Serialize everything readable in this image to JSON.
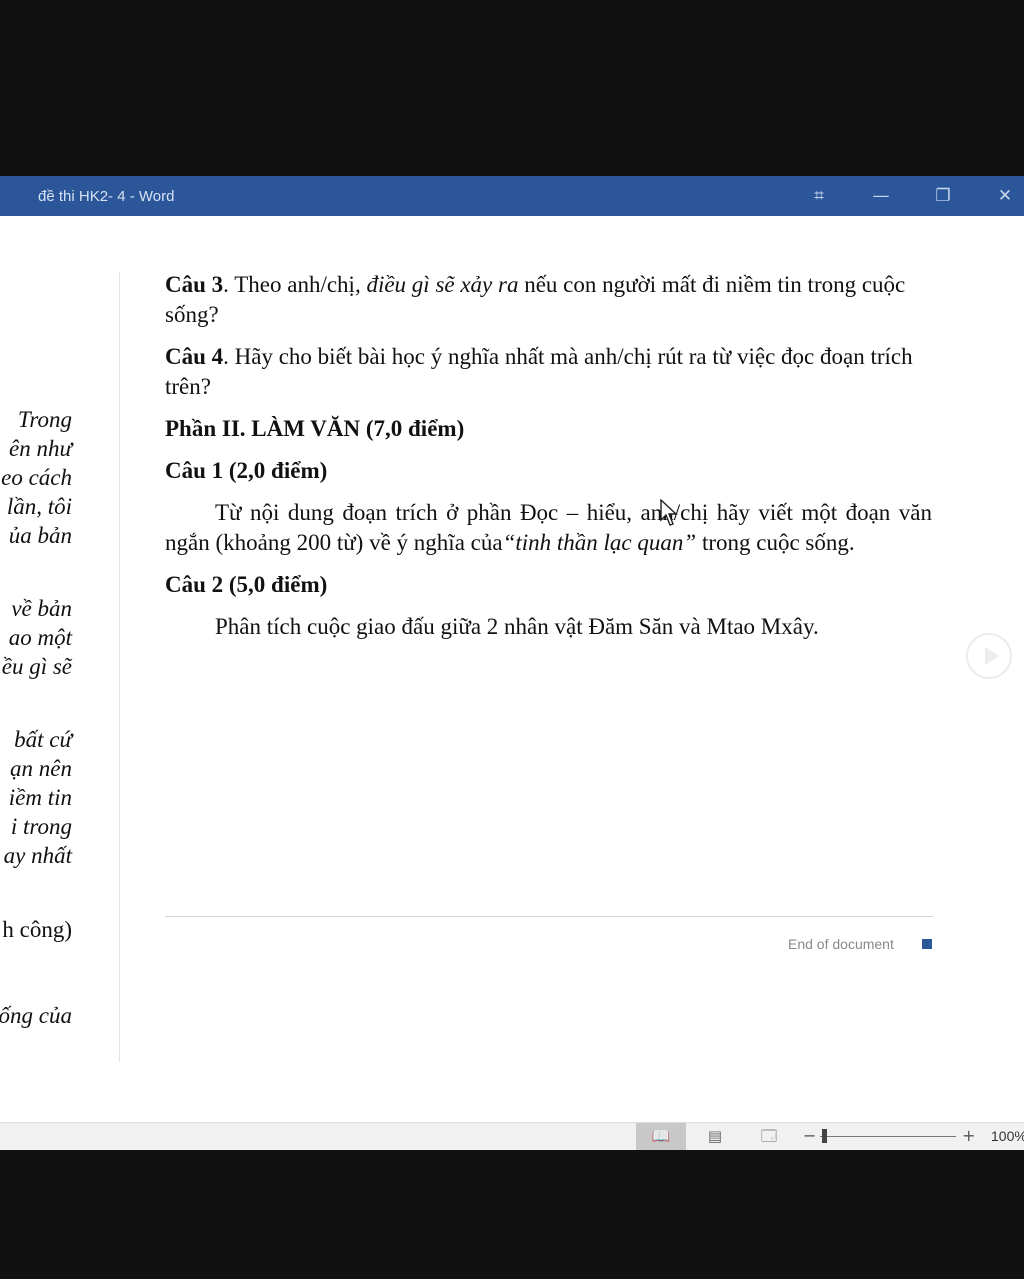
{
  "window": {
    "title": "đề thi HK2- 4  -  Word",
    "controls": {
      "fullscreen": "⌗",
      "minimize": "—",
      "restore": "❐",
      "close": "✕"
    }
  },
  "left_page_fragments": [
    "Trong",
    "ên như",
    "eo cách",
    "lần, tôi",
    "ủa bản",
    "về bản",
    "ao một",
    "ều gì sẽ",
    "bất cứ",
    "ạn nên",
    "iềm tin",
    "i trong",
    "ay nhất",
    "h công)",
    "ống của"
  ],
  "document": {
    "cau3": {
      "label": "Câu 3",
      "text_before": ". Theo anh/chị, ",
      "italic": "điều gì sẽ xảy ra",
      "text_after": " nếu con người mất đi niềm tin trong cuộc sống?"
    },
    "cau4": {
      "label": "Câu 4",
      "text": ". Hãy cho biết bài học ý nghĩa nhất mà anh/chị rút ra từ việc đọc đoạn trích trên?"
    },
    "phan2_heading": "Phần II. LÀM VĂN (7,0 điểm)",
    "cau1_heading": "Câu 1 (2,0 điểm)",
    "cau1_body": {
      "text_before": "Từ nội dung đoạn trích ở phần Đọc – hiểu, anh/chị hãy viết một đoạn văn ngắn (khoảng 200 từ) về ý nghĩa của",
      "italic": "“tinh thần lạc quan”",
      "text_after": " trong cuộc sống."
    },
    "cau2_heading": "Câu 2 (5,0 điểm)",
    "cau2_body": "Phân tích cuộc giao đấu giữa 2 nhân vật Đăm Săn và Mtao Mxây.",
    "end_of_document": "End of document"
  },
  "statusbar": {
    "views": {
      "read_mode": "📖",
      "print_layout": "▤",
      "web_layout": "🗔"
    },
    "zoom_minus": "−",
    "zoom_plus": "+",
    "zoom_level": "100%"
  },
  "colors": {
    "titlebar": "#2b579a",
    "end_marker": "#2b579a"
  }
}
